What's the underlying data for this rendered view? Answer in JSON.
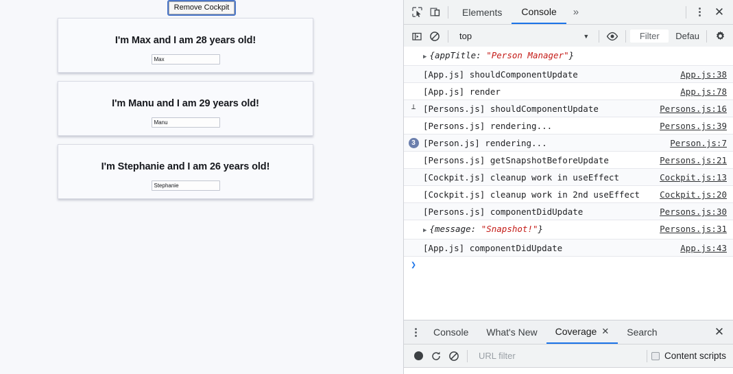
{
  "app": {
    "remove_cockpit_button": "Remove Cockpit",
    "persons": [
      {
        "title": "I'm Max and I am 28 years old!",
        "input_value": "Max"
      },
      {
        "title": "I'm Manu and I am 29 years old!",
        "input_value": "Manu"
      },
      {
        "title": "I'm Stephanie and I am 26 years old!",
        "input_value": "Stephanie"
      }
    ]
  },
  "devtools": {
    "main_toolbar": {
      "inspect_icon": "inspect-element-icon",
      "device_icon": "device-toolbar-icon",
      "tabs": [
        {
          "label": "Elements",
          "active": false
        },
        {
          "label": "Console",
          "active": true
        }
      ],
      "more_tabs": "»",
      "kebab_icon": "more-options-icon",
      "close_icon": "close-icon"
    },
    "console_toolbar": {
      "sidebar_icon": "console-sidebar-icon",
      "clear_icon": "clear-console-icon",
      "context": "top",
      "caret": "▼",
      "eye_icon": "live-expression-icon",
      "filter_placeholder": "Filter",
      "level": "Defau",
      "settings_icon": "settings-gear-icon"
    },
    "console_rows": [
      {
        "gutter": "",
        "kind": "object",
        "prefix": "{appTitle: ",
        "string": "\"Person Manager\"",
        "suffix": "}",
        "source": "",
        "alt": false
      },
      {
        "gutter": "",
        "kind": "text",
        "message": "[App.js] shouldComponentUpdate",
        "source": "App.js:38",
        "alt": true
      },
      {
        "gutter": "",
        "kind": "text",
        "message": "[App.js] render",
        "source": "App.js:78",
        "alt": false
      },
      {
        "gutter": "tick",
        "kind": "text",
        "message": "[Persons.js] shouldComponentUpdate",
        "source": "Persons.js:16",
        "alt": true
      },
      {
        "gutter": "",
        "kind": "text",
        "message": "[Persons.js] rendering...",
        "source": "Persons.js:39",
        "alt": false
      },
      {
        "gutter": "3",
        "kind": "text",
        "message": "[Person.js] rendering...",
        "source": "Person.js:7",
        "alt": true
      },
      {
        "gutter": "",
        "kind": "text",
        "message": "[Persons.js] getSnapshotBeforeUpdate",
        "source": "Persons.js:21",
        "alt": false
      },
      {
        "gutter": "",
        "kind": "text",
        "message": "[Cockpit.js] cleanup work in useEffect",
        "source": "Cockpit.js:13",
        "alt": true
      },
      {
        "gutter": "",
        "kind": "text",
        "message": "[Cockpit.js] cleanup work in 2nd useEffect",
        "source": "Cockpit.js:20",
        "alt": false
      },
      {
        "gutter": "",
        "kind": "text",
        "message": "[Persons.js] componentDidUpdate",
        "source": "Persons.js:30",
        "alt": true
      },
      {
        "gutter": "",
        "kind": "object",
        "prefix": "{message: ",
        "string": "\"Snapshot!\"",
        "suffix": "}",
        "source": "Persons.js:31",
        "alt": false
      },
      {
        "gutter": "",
        "kind": "text",
        "message": "[App.js] componentDidUpdate",
        "source": "App.js:43",
        "alt": true
      }
    ],
    "prompt_symbol": "❯",
    "drawer": {
      "kebab_icon": "drawer-more-options-icon",
      "tabs": [
        {
          "label": "Console",
          "active": false,
          "closable": false
        },
        {
          "label": "What's New",
          "active": false,
          "closable": false
        },
        {
          "label": "Coverage",
          "active": true,
          "closable": true
        },
        {
          "label": "Search",
          "active": false,
          "closable": false
        }
      ],
      "close_icon": "drawer-close-icon",
      "toolbar": {
        "record_icon": "record-button-icon",
        "reload_icon": "reload-icon",
        "clear_icon": "clear-icon",
        "url_filter_placeholder": "URL filter",
        "content_scripts_label": "Content scripts",
        "content_scripts_checked": false
      }
    }
  },
  "colors": {
    "accent": "#1a73e8",
    "toolbar_bg": "#f1f3f4",
    "page_bg": "#f7f8fb",
    "string_red": "#c41a16",
    "badge_blue": "#6b7fad"
  }
}
